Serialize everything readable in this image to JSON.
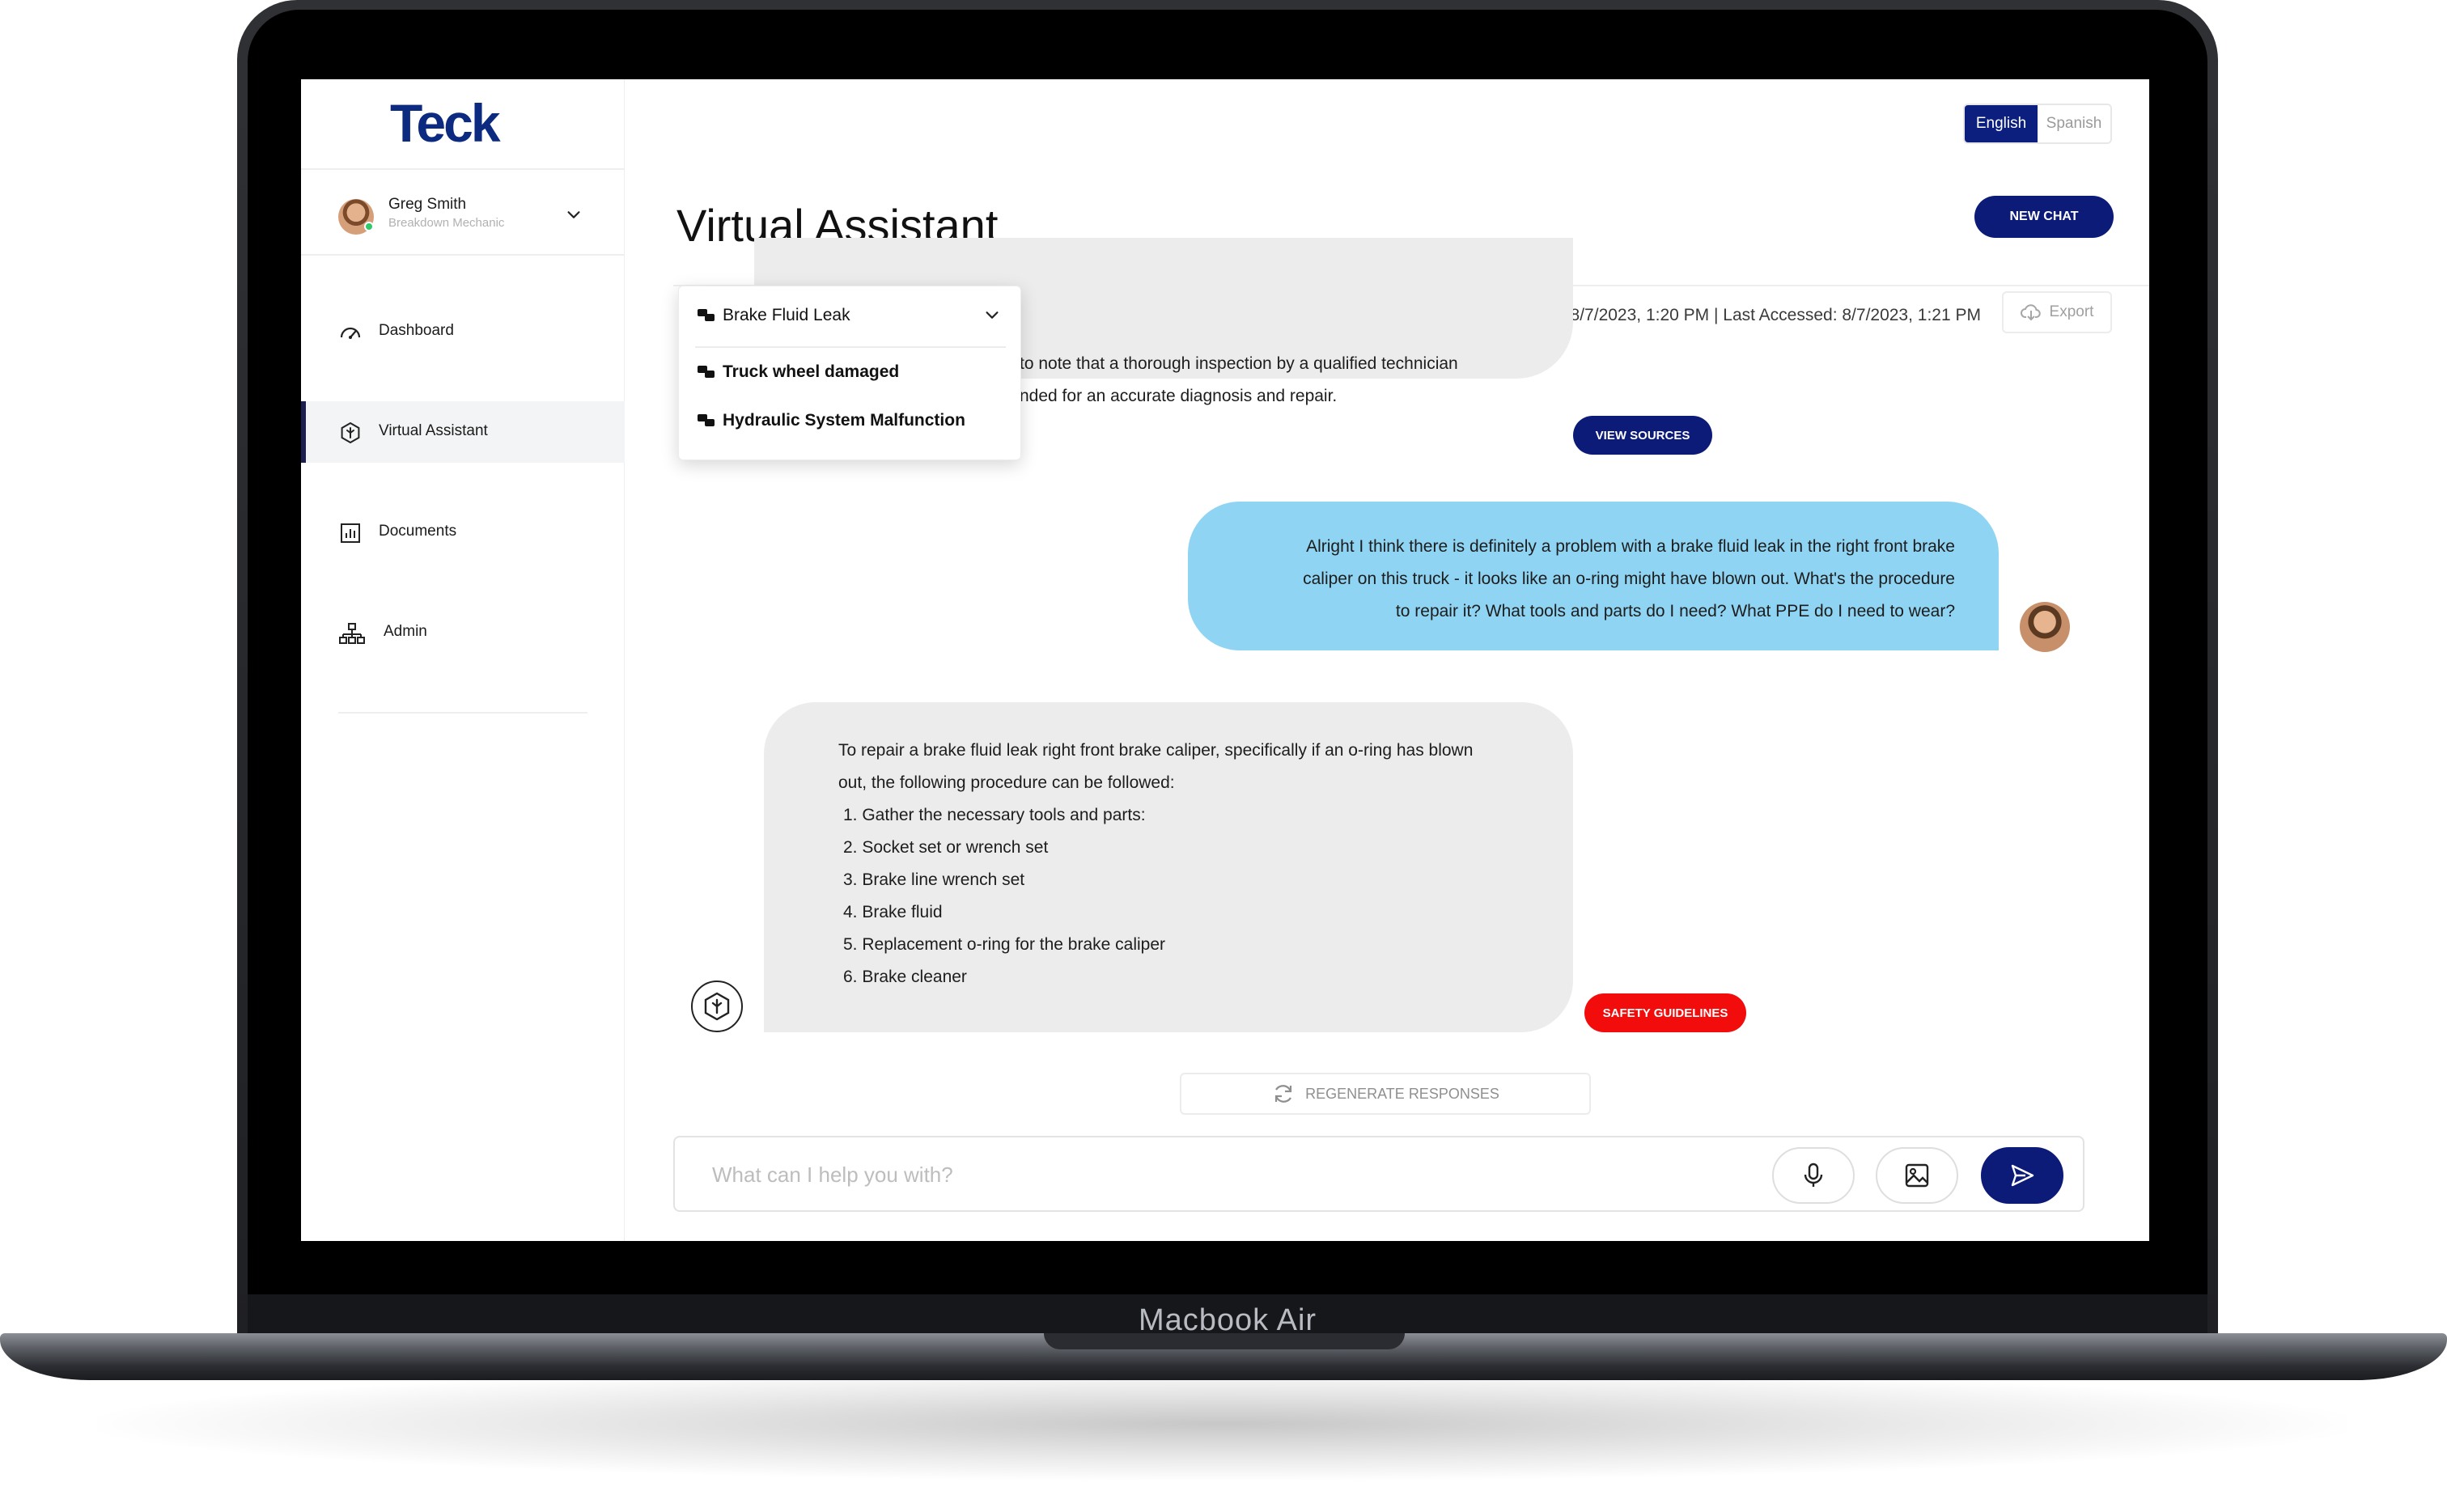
{
  "device": {
    "label": "Macbook Air"
  },
  "brand": {
    "logo_text": "Teck",
    "navy": "#0c1a78",
    "danger": "#f20c0c",
    "user_bubble": "#8fd4f3",
    "bot_bubble": "#ececec"
  },
  "user": {
    "name": "Greg Smith",
    "role": "Breakdown Mechanic",
    "status": "online"
  },
  "sidebar": {
    "items": [
      {
        "label": "Dashboard",
        "icon": "gauge-icon",
        "active": false
      },
      {
        "label": "Virtual Assistant",
        "icon": "hexagon-assistant-icon",
        "active": true
      },
      {
        "label": "Documents",
        "icon": "bar-chart-document-icon",
        "active": false
      },
      {
        "label": "Admin",
        "icon": "org-chart-icon",
        "active": false
      }
    ]
  },
  "header": {
    "languages": [
      {
        "label": "English",
        "selected": true
      },
      {
        "label": "Spanish",
        "selected": false
      }
    ],
    "title": "Virtual Assistant",
    "new_chat": "NEW CHAT"
  },
  "conversation": {
    "selected_topic": "Brake Fluid Leak",
    "topics": [
      "Truck wheel damaged",
      "Hydraulic System Malfunction"
    ],
    "meta": "Created 8/7/2023, 1:20 PM | Last Accessed: 8/7/2023, 1:21 PM",
    "export_label": "Export"
  },
  "messages": {
    "bot_1": {
      "lines": [
        "to note that a thorough inspection by a qualified technician",
        "nded for an accurate diagnosis and repair."
      ],
      "action": "VIEW SOURCES"
    },
    "user_1": {
      "lines": [
        "Alright I think there is definitely a problem with a brake fluid leak in the right front brake",
        "caliper on this truck - it looks like an o-ring might have blown out. What's the procedure",
        "to repair it? What tools and parts do I need? What PPE do I need to wear?"
      ]
    },
    "bot_2": {
      "intro_lines": [
        "To repair a brake fluid leak right front brake caliper, specifically if an o-ring has blown",
        "out, the following procedure can be followed:"
      ],
      "steps": [
        "1.  Gather the necessary tools and parts:",
        "2.  Socket set or wrench set",
        "3.  Brake line wrench set",
        "4.  Brake fluid",
        "5.  Replacement o-ring for the brake caliper",
        "6.  Brake cleaner"
      ],
      "action": "SAFETY GUIDELINES"
    }
  },
  "regenerate": "REGENERATE RESPONSES",
  "composer": {
    "placeholder": "What can I help you with?",
    "value": ""
  }
}
